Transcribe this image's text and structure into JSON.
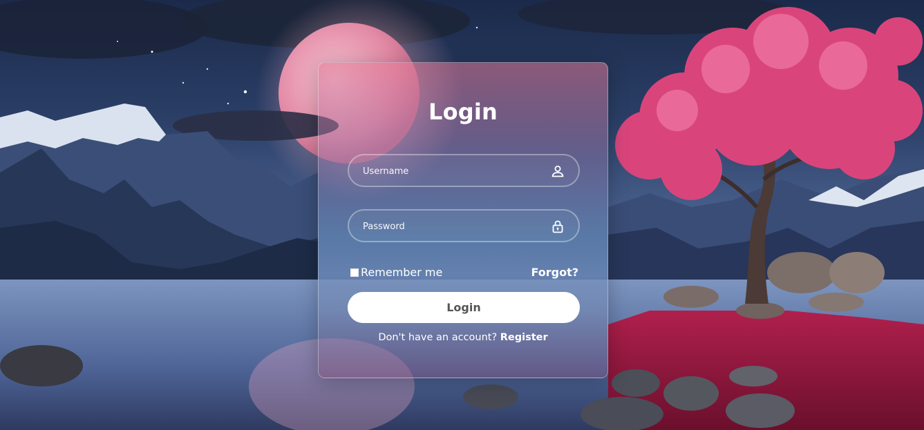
{
  "login": {
    "title": "Login",
    "username_placeholder": "Username",
    "password_placeholder": "Password",
    "remember_label": "Remember me",
    "forgot_label": "Forgot?",
    "submit_label": "Login",
    "register_prompt": "Don't have an account?",
    "register_link": "Register",
    "username_icon": "user-icon",
    "password_icon": "lock-icon"
  }
}
